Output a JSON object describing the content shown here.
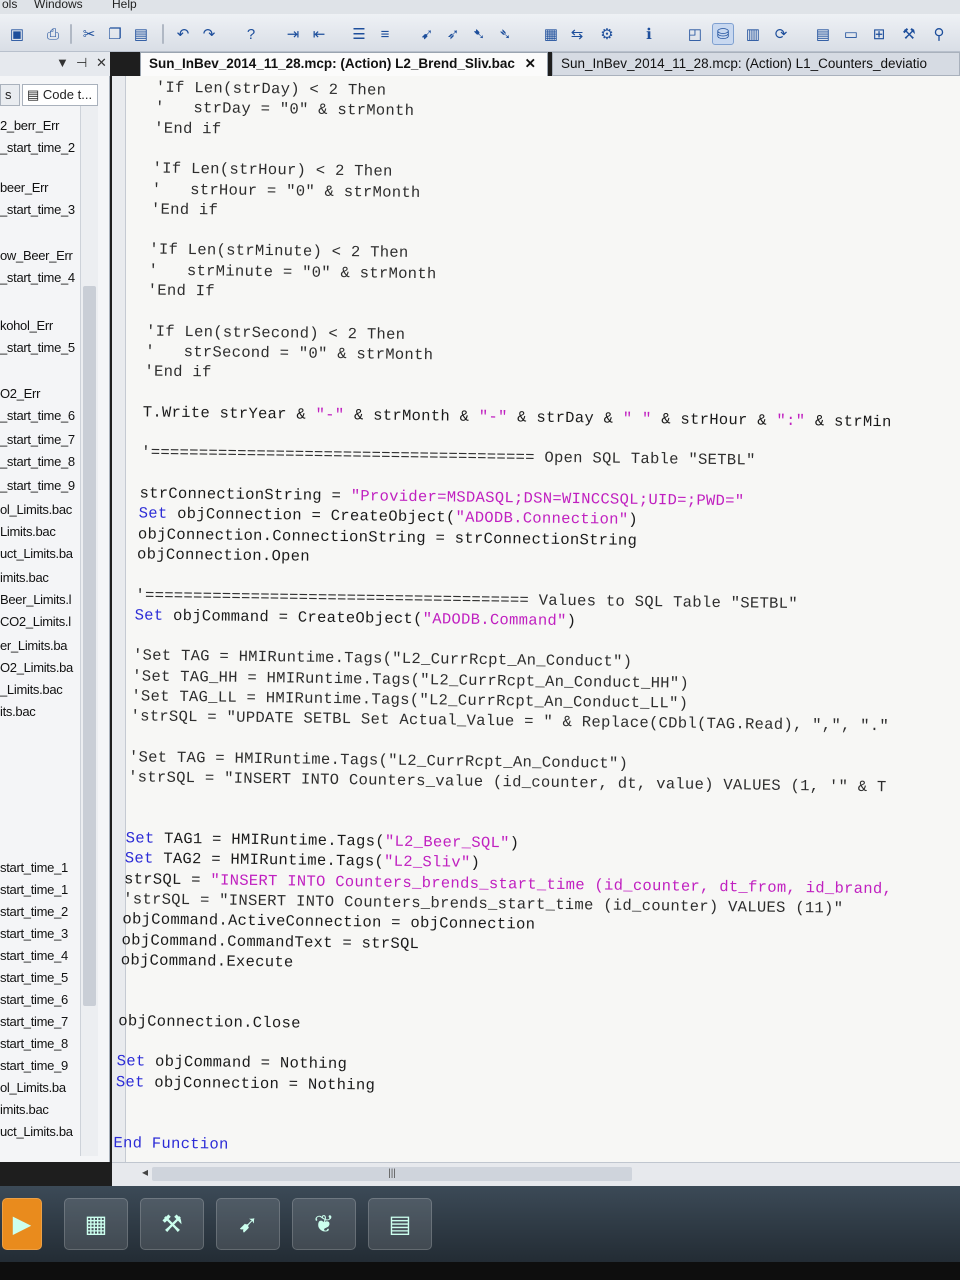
{
  "menu": {
    "tools": "ols",
    "windows": "Windows",
    "help": "Help"
  },
  "tabs": [
    {
      "label": "Sun_InBev_2014_11_28.mcp: (Action) L2_Brend_Sliv.bac",
      "close": "✕"
    },
    {
      "label": "Sun_InBev_2014_11_28.mcp: (Action) L1_Counters_deviatio"
    }
  ],
  "sidebar": {
    "header_icons": {
      "dropdown": "▼",
      "pin": "📌",
      "close": "✕"
    },
    "tabs": [
      "s",
      "Code t..."
    ],
    "items": [
      "2_berr_Err",
      "_start_time_2",
      "beer_Err",
      "_start_time_3",
      "ow_Beer_Err",
      "_start_time_4",
      "kohol_Err",
      "_start_time_5",
      "O2_Err",
      "_start_time_6",
      "_start_time_7",
      "_start_time_8",
      "_start_time_9",
      "ol_Limits.bac",
      "Limits.bac",
      "uct_Limits.ba",
      "imits.bac",
      "Beer_Limits.l",
      "CO2_Limits.l",
      "er_Limits.ba",
      "O2_Limits.ba",
      "_Limits.bac",
      "its.bac",
      "start_time_1",
      "start_time_1",
      "start_time_2",
      "start_time_3",
      "start_time_4",
      "start_time_5",
      "start_time_6",
      "start_time_7",
      "start_time_8",
      "start_time_9",
      "ol_Limits.ba",
      "imits.bac",
      "uct_Limits.ba"
    ]
  },
  "code": [
    "'If Len(strDay) < 2 Then",
    "'   strDay = \"0\" & strMonth",
    "'End if",
    "",
    "'If Len(strHour) < 2 Then",
    "'   strHour = \"0\" & strMonth",
    "'End if",
    "",
    "'If Len(strMinute) < 2 Then",
    "'   strMinute = \"0\" & strMonth",
    "'End If",
    "",
    "'If Len(strSecond) < 2 Then",
    "'   strSecond = \"0\" & strMonth",
    "'End if",
    "",
    "T.Write strYear & \"-\" & strMonth & \"-\" & strDay & \" \" & strHour & \":\" & strMin",
    "",
    "'======================================== Open SQL Table \"SETBL\"",
    "",
    "strConnectionString = \"Provider=MSDASQL;DSN=WINCCSQL;UID=;PWD=\"",
    "Set objConnection = CreateObject(\"ADODB.Connection\")",
    "objConnection.ConnectionString = strConnectionString",
    "objConnection.Open",
    "",
    "'======================================== Values to SQL Table \"SETBL\"",
    "Set objCommand = CreateObject(\"ADODB.Command\")",
    "",
    "'Set TAG = HMIRuntime.Tags(\"L2_CurrRcpt_An_Conduct\")",
    "'Set TAG_HH = HMIRuntime.Tags(\"L2_CurrRcpt_An_Conduct_HH\")",
    "'Set TAG_LL = HMIRuntime.Tags(\"L2_CurrRcpt_An_Conduct_LL\")",
    "'strSQL = \"UPDATE SETBL Set Actual_Value = \" & Replace(CDbl(TAG.Read), \",\", \".\"",
    "",
    "'Set TAG = HMIRuntime.Tags(\"L2_CurrRcpt_An_Conduct\")",
    "'strSQL = \"INSERT INTO Counters_value (id_counter, dt, value) VALUES (1, '\" & T",
    "",
    "",
    "Set TAG1 = HMIRuntime.Tags(\"L2_Beer_SQL\")",
    "Set TAG2 = HMIRuntime.Tags(\"L2_Sliv\")",
    "strSQL = \"INSERT INTO Counters_brends_start_time (id_counter, dt_from, id_brand,",
    "'strSQL = \"INSERT INTO Counters_brends_start_time (id_counter) VALUES (11)\"",
    "objCommand.ActiveConnection = objConnection",
    "objCommand.CommandText = strSQL",
    "objCommand.Execute",
    "",
    "",
    "objConnection.Close",
    "",
    "Set objCommand = Nothing",
    "Set objConnection = Nothing",
    "",
    "",
    "End Function"
  ],
  "colors": {
    "keyword": "#2b2bd6",
    "string": "#c020c0",
    "text": "#1a1a1a"
  },
  "taskbar_icons": [
    "start-media-icon",
    "explorer-icon",
    "tools-icon",
    "wincc-icon",
    "leaf-icon",
    "vbs-icon"
  ]
}
